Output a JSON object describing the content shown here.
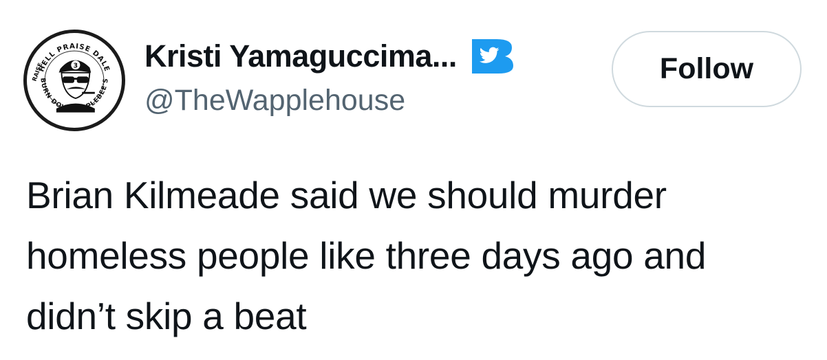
{
  "author": {
    "display_name": "Kristi Yamaguccima...",
    "handle": "@TheWapplehouse",
    "avatar_ring_text_top": "HELL PRAISE DALE",
    "avatar_ring_text_left": "RAISE",
    "avatar_ring_text_bottom": "BURN DOWN APPLEBEE'S",
    "avatar_badge_number": "3",
    "badge_icon": "twitter-bird-icon",
    "badge_letter": "B",
    "badge_color": "#1d9bf0"
  },
  "follow_button": {
    "label": "Follow"
  },
  "tweet": {
    "lines": [
      "Brian Kilmeade said we should murder",
      "homeless people like three days ago and",
      "didn’t skip a beat"
    ]
  }
}
